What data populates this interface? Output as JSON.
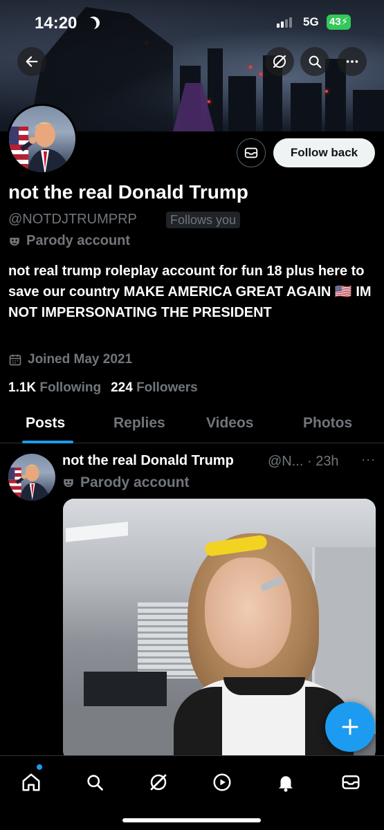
{
  "status_bar": {
    "time": "14:20",
    "network": "5G",
    "battery": "43"
  },
  "header_icons": {
    "back": "arrow-left-icon",
    "grok": "grok-icon",
    "search": "search-icon",
    "more": "more-icon"
  },
  "profile": {
    "name": "not the real Donald Trump",
    "handle": "@NOTDJTRUMPRP",
    "follows_you": "Follows you",
    "parody_label": "Parody account",
    "bio": "not real trump roleplay account for fun 18 plus here to save our country MAKE AMERICA GREAT AGAIN 🇺🇸 IM NOT IMPERSONATING THE PRESIDENT",
    "joined": "Joined May 2021",
    "following_count": "1.1K",
    "following_label": "Following",
    "followers_count": "224",
    "followers_label": "Followers"
  },
  "actions": {
    "follow_back": "Follow back"
  },
  "tabs": [
    {
      "label": "Posts",
      "active": true
    },
    {
      "label": "Replies",
      "active": false
    },
    {
      "label": "Videos",
      "active": false
    },
    {
      "label": "Photos",
      "active": false
    }
  ],
  "post": {
    "name": "not the real Donald Trump",
    "handle_time": "@N... · 23h",
    "more": "···",
    "parody_label": "Parody account"
  },
  "bottom_nav": [
    "home-icon",
    "search-icon",
    "grok-icon",
    "play-icon",
    "bell-icon",
    "mail-icon"
  ],
  "colors": {
    "accent": "#1d9bf0",
    "muted": "#71767b",
    "battery": "#34c759"
  }
}
